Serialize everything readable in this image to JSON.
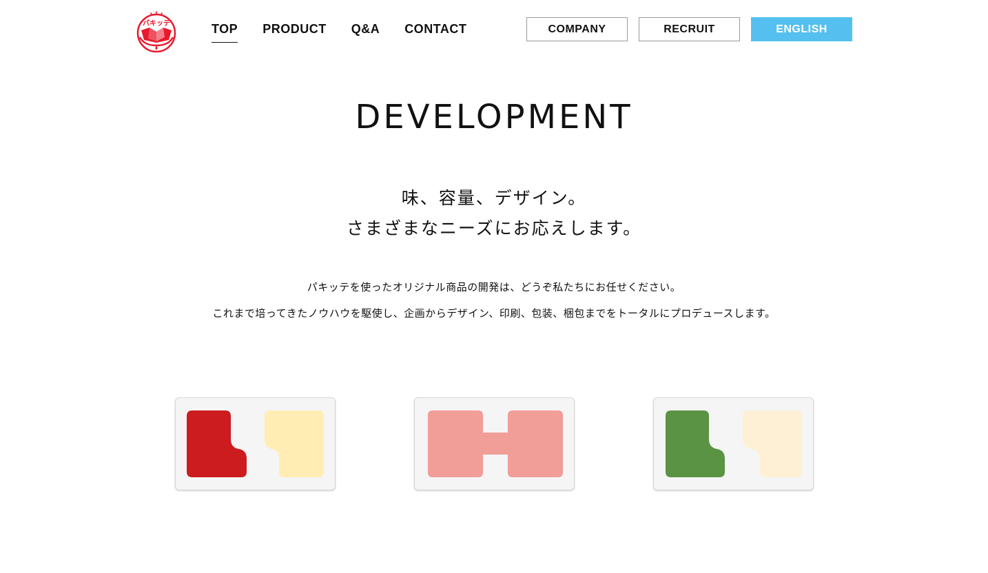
{
  "header": {
    "logo_text": "パキッテ",
    "nav": [
      {
        "label": "TOP",
        "active": true
      },
      {
        "label": "PRODUCT",
        "active": false
      },
      {
        "label": "Q&A",
        "active": false
      },
      {
        "label": "CONTACT",
        "active": false
      }
    ],
    "buttons": [
      {
        "label": "COMPANY"
      },
      {
        "label": "RECRUIT"
      },
      {
        "label": "ENGLISH"
      }
    ]
  },
  "main": {
    "title": "DEVELOPMENT",
    "headline": [
      "味、容量、デザイン。",
      "さまざまなニーズにお応えします。"
    ],
    "body": [
      "パキッテを使ったオリジナル商品の開発は、どうぞ私たちにお任せください。",
      "これまで培ってきたノウハウを駆使し、企画からデザイン、印刷、包装、梱包までをトータルにプロデュースします。"
    ]
  },
  "colors": {
    "accent": "#55c0ef",
    "logo_red": "#e8192c",
    "card_1_left": "#cc1c1f",
    "card_1_right": "#ffedb3",
    "card_2": "#f19d98",
    "card_3_left": "#5a9344",
    "card_3_right": "#fdf0d5"
  }
}
